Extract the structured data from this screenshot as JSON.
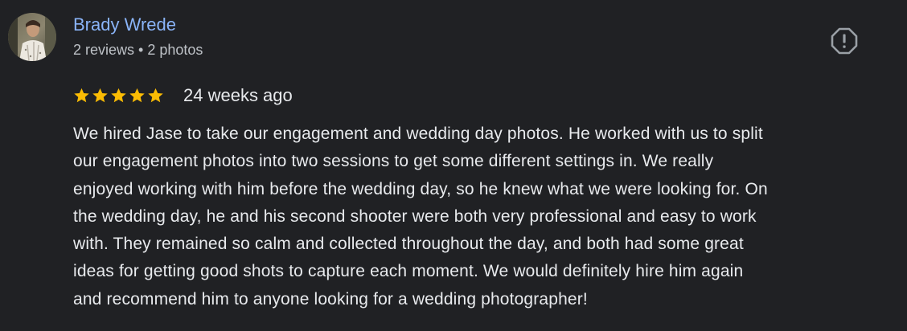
{
  "review": {
    "reviewer_name": "Brady Wrede",
    "reviewer_meta": "2 reviews • 2 photos",
    "rating": 5,
    "rating_max": 5,
    "date": "24 weeks ago",
    "text_lines": [
      "We hired Jase to take our engagement and wedding day photos. He worked with us to split",
      "our engagement photos into two sessions to get some different settings in. We really",
      "enjoyed working with him before the wedding day, so he knew what we were looking for. On",
      "the wedding day, he and his second shooter were both very professional and easy to work",
      "with. They remained so calm and collected throughout the day, and both had some great",
      "ideas for getting good shots to capture each moment. We would definitely hire him again",
      "and recommend him to anyone looking for a wedding photographer!"
    ],
    "report_icon": "report-icon"
  },
  "colors": {
    "background": "#202124",
    "name": "#8ab4f8",
    "star": "#fbbc04",
    "text": "#e8eaed",
    "meta": "#bdc1c6",
    "icon": "#9aa0a6"
  }
}
